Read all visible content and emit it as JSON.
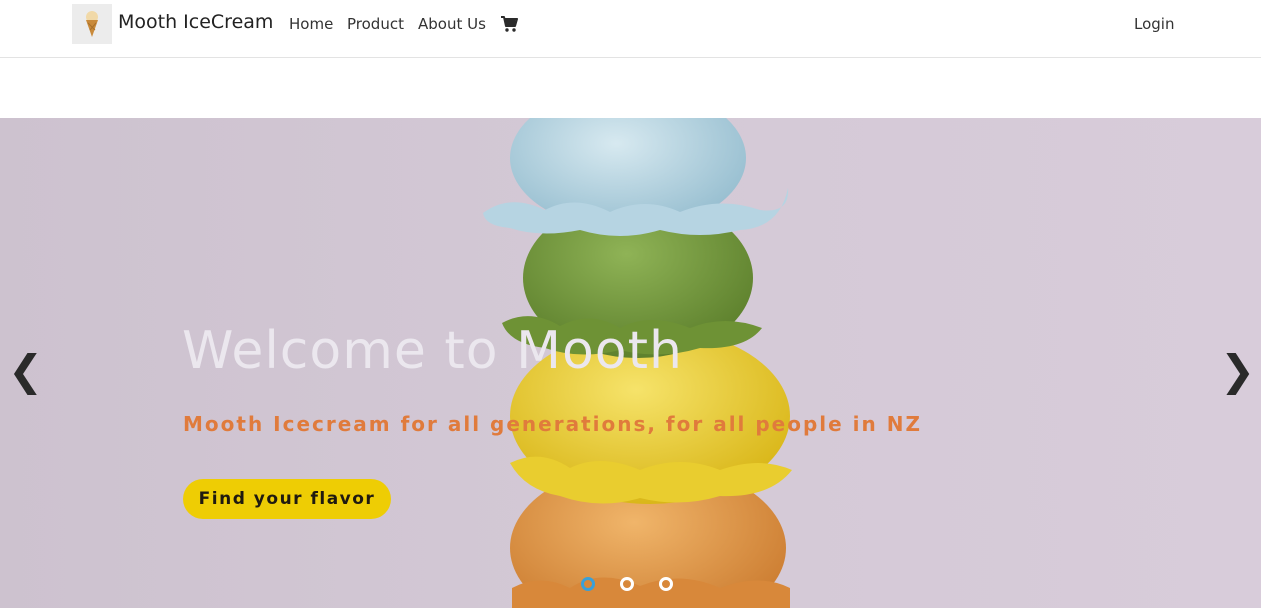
{
  "navbar": {
    "brand": "Mooth IceCream",
    "links": [
      {
        "label": "Home"
      },
      {
        "label": "Product"
      },
      {
        "label": "About Us"
      }
    ],
    "cart_icon": "shopping-cart-icon",
    "login": "Login"
  },
  "hero": {
    "title": "Welcome to Mooth",
    "subtitle": "Mooth Icecream for all generations, for all people in NZ",
    "cta": "Find your flavor",
    "prev_arrow": "❮",
    "next_arrow": "❯",
    "slides_total": 3,
    "active_slide": 1
  },
  "colors": {
    "hero_bg": "#d4c9d6",
    "cta_bg": "#eecd04",
    "subtitle": "#e07b3c",
    "active_dot": "#3aa0d8"
  }
}
